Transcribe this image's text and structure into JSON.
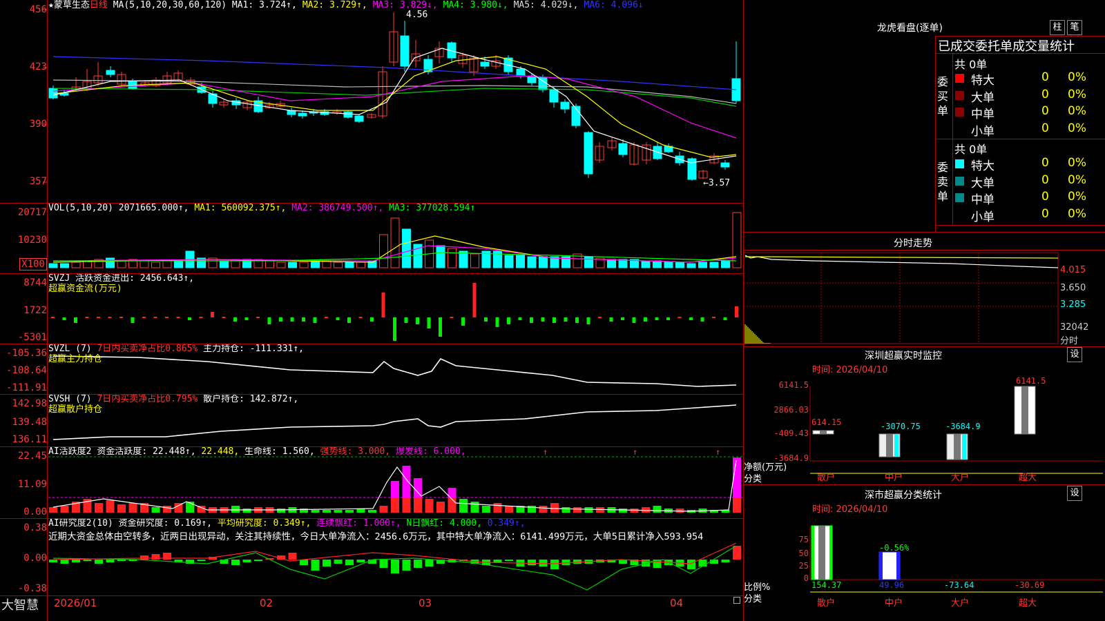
{
  "main": {
    "star": "★",
    "name": "蒙草生态",
    "period": "日线",
    "ma_label": "MA(5,10,20,30,60,120)",
    "mas": [
      {
        "label": "MA1: 3.724↑,",
        "color": "#ffffff"
      },
      {
        "label": "MA2: 3.729↑,",
        "color": "#ffff00"
      },
      {
        "label": "MA3: 3.829↓,",
        "color": "#ff00ff"
      },
      {
        "label": "MA4: 3.980↓,",
        "color": "#00ff00"
      },
      {
        "label": "MA5: 4.029↓,",
        "color": "#dddddd"
      },
      {
        "label": "MA6: 4.096↓",
        "color": "#3333ff"
      }
    ],
    "axis": [
      "456",
      "423",
      "390",
      "357"
    ],
    "high_label": "4.56",
    "low_label": "←3.57"
  },
  "vol": {
    "title": "VOL(5,10,20)",
    "value": "2071665.000↑,",
    "ma1": "MA1: 560092.375↑,",
    "ma2": "MA2: 386749.500↑,",
    "ma3": "MA3: 377028.594↑",
    "axis": [
      "20717",
      "10230",
      "X100"
    ]
  },
  "svzj": {
    "title": "SVZJ  活跃资金进出: 2456.643↑,",
    "subtitle": "超赢资金流(万元)",
    "axis": [
      "8744",
      "1722",
      "-5301"
    ]
  },
  "svzl": {
    "title_a": "SVZL (7)",
    "title_b": "7日内买卖净占比0.865%",
    "title_c": "主力持仓: -111.331↑,",
    "subtitle": "超赢主力持仓",
    "axis": [
      "-105.36",
      "-108.64",
      "-111.91"
    ]
  },
  "svsh": {
    "title_a": "SVSH (7)",
    "title_b": "7日内买卖净占比0.795%",
    "title_c": "散户持仓: 142.872↑,",
    "subtitle": "超赢散户持仓",
    "axis": [
      "142.98",
      "139.48",
      "136.11"
    ]
  },
  "ai1": {
    "title_a": "AI活跃度2",
    "title_b": "资金活跃度: 22.448↑,",
    "title_c": "22.448,",
    "title_d": "生命线: 1.560,",
    "title_e": "强势线: 3.000,",
    "title_f": "爆发线: 6.000,",
    "axis": [
      "22.45",
      "11.09",
      "0.00"
    ]
  },
  "ai2": {
    "title_a": "AI研究度2(10)",
    "title_b": "资金研究度: 0.169↑,",
    "title_c": "平均研究度: 0.349↑,",
    "title_d": "连续飘红: 1.000↑,",
    "title_e": "N日飘红: 4.000,",
    "title_f": "0.349↑,",
    "comment": "近期大资金总体由空转多，近两日出现异动，关注其持续性，今日大单净流入：2456.6万元，其中特大单净流入：6141.499万元，大单5日累计净入593.954",
    "axis": [
      "0.38",
      "0.00",
      "-0.38"
    ]
  },
  "dates": {
    "logo": "大智慧",
    "d1": "2026/01",
    "d2": "02",
    "d3": "03",
    "d4": "04"
  },
  "right": {
    "lhb_title": "龙虎看盘(逐单)",
    "btn_col": "柱",
    "btn_pen": "笔",
    "stat_title": "已成交委托单成交量统计",
    "buy_label": "委买单",
    "sell_label": "委卖单",
    "buy_total": "共 0单",
    "sell_total": "共 0单",
    "rows": [
      {
        "name": "特大",
        "val": "0",
        "pct": "0%"
      },
      {
        "name": "大单",
        "val": "0",
        "pct": "0%"
      },
      {
        "name": "中单",
        "val": "0",
        "pct": "0%"
      },
      {
        "name": "小单",
        "val": "0",
        "pct": "0%"
      }
    ],
    "fenshi_title": "分时走势",
    "fenshi_axis": [
      "4.015",
      "3.650",
      "3.285",
      "32042",
      "分时"
    ],
    "sz_title": "深圳超赢实时监控",
    "btn_set": "设",
    "sz_time": "时间: 2026/04/10",
    "sz_axis": [
      "6141.5",
      "2866.03",
      "-409.43",
      "-3684.9"
    ],
    "sz_unit1": "净额(万元)",
    "sz_unit2": "分类",
    "sz_cats": [
      "散户",
      "中户",
      "大户",
      "超大"
    ],
    "sz_values": [
      "614.15",
      "-3070.75",
      "-3684.9",
      "6141.5"
    ],
    "cls_title": "深市超赢分类统计",
    "cls_time": "时间: 2026/04/10",
    "cls_axis": [
      "75",
      "50",
      "25",
      "0"
    ],
    "cls_unit1": "比例%",
    "cls_unit2": "分类",
    "cls_top": "-0.56%",
    "cls_values": [
      "154.37",
      "49.96",
      "-73.64",
      "-30.69"
    ],
    "cls_cats": [
      "散户",
      "中户",
      "大户",
      "超大"
    ]
  }
}
